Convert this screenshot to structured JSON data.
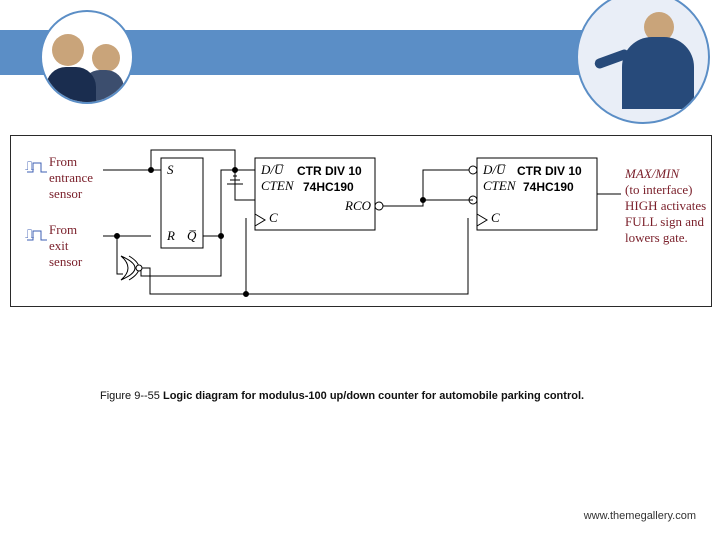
{
  "header": {
    "banner_color": "#5b8ec6"
  },
  "inputs": {
    "entrance": "From\nentrance\nsensor",
    "exit": "From\nexit\nsensor",
    "pulse_symbol": "⎍"
  },
  "latch": {
    "s": "S",
    "r": "R",
    "qbar": "Q̅"
  },
  "ctr": {
    "du": "D/U̅",
    "cten": "CTEN",
    "c": "C",
    "rco": "RCO",
    "title": "CTR DIV 10",
    "part": "74HC190"
  },
  "ground": "⏚",
  "output": {
    "label": "MAX/MIN",
    "lines": "(to interface)\nHIGH activates\nFULL sign and\nlowers gate."
  },
  "caption": {
    "fig": "Figure 9--55",
    "text": "   Logic diagram for modulus-100 up/down counter for automobile parking control."
  },
  "footer": "www.themegallery.com"
}
